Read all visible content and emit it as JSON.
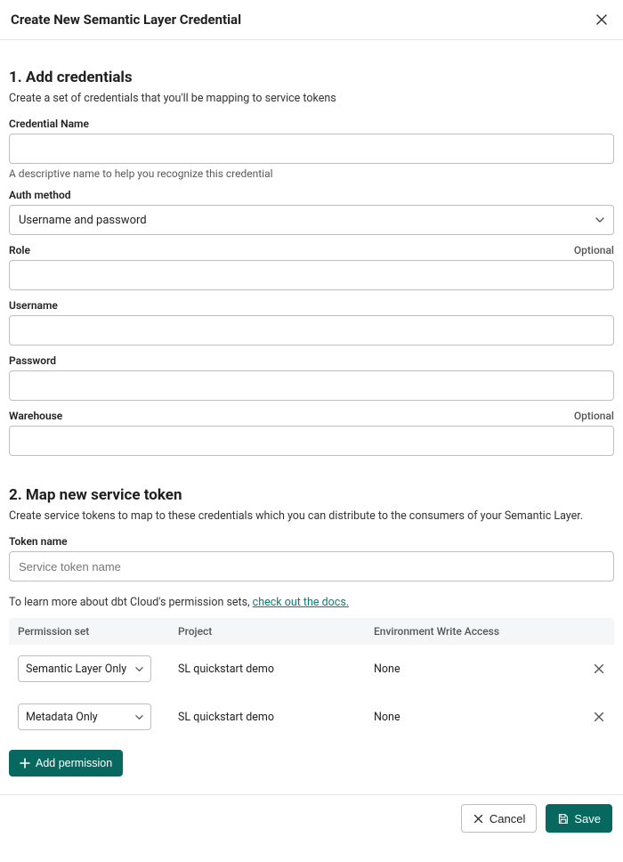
{
  "header": {
    "title": "Create New Semantic Layer Credential"
  },
  "section1": {
    "title": "1. Add credentials",
    "desc": "Create a set of credentials that you'll be mapping to service tokens",
    "cred_name": {
      "label": "Credential Name",
      "value": "",
      "helper": "A descriptive name to help you recognize this credential"
    },
    "auth_method": {
      "label": "Auth method",
      "value": "Username and password"
    },
    "role": {
      "label": "Role",
      "optional": "Optional",
      "value": ""
    },
    "username": {
      "label": "Username",
      "value": ""
    },
    "password": {
      "label": "Password",
      "value": ""
    },
    "warehouse": {
      "label": "Warehouse",
      "optional": "Optional",
      "value": ""
    }
  },
  "section2": {
    "title": "2. Map new service token",
    "desc": "Create service tokens to map to these credentials which you can distribute to the consumers of your Semantic Layer.",
    "token_name": {
      "label": "Token name",
      "placeholder": "Service token name",
      "value": ""
    },
    "docs_prefix": "To learn more about dbt Cloud's permission sets, ",
    "docs_link": "check out the docs.",
    "head": {
      "perm": "Permission set",
      "project": "Project",
      "env": "Environment Write Access"
    },
    "rows": [
      {
        "perm": "Semantic Layer Only",
        "project": "SL quickstart demo",
        "env": "None"
      },
      {
        "perm": "Metadata Only",
        "project": "SL quickstart demo",
        "env": "None"
      }
    ],
    "add_perm": "Add permission"
  },
  "footer": {
    "cancel": "Cancel",
    "save": "Save"
  }
}
